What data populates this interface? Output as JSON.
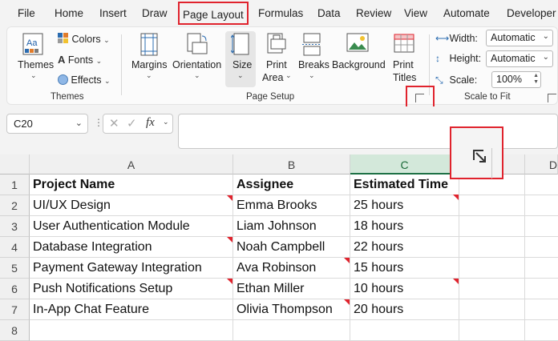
{
  "tabs": [
    "File",
    "Home",
    "Insert",
    "Draw",
    "Page Layout",
    "Formulas",
    "Data",
    "Review",
    "View",
    "Automate",
    "Developer"
  ],
  "active_tab": "Page Layout",
  "ribbon": {
    "themes_group": {
      "themes_label": "Themes",
      "colors_label": "Colors",
      "fonts_label": "Fonts",
      "effects_label": "Effects",
      "group_label": "Themes"
    },
    "page_setup_group": {
      "margins_label": "Margins",
      "orientation_label": "Orientation",
      "size_label": "Size",
      "print_area_label_1": "Print",
      "print_area_label_2": "Area",
      "breaks_label": "Breaks",
      "background_label": "Background",
      "print_titles_label_1": "Print",
      "print_titles_label_2": "Titles",
      "group_label": "Page Setup"
    },
    "scale_group": {
      "width_label": "Width:",
      "width_value": "Automatic",
      "height_label": "Height:",
      "height_value": "Automatic",
      "scale_label": "Scale:",
      "scale_value": "100%",
      "group_label": "Scale to Fit"
    }
  },
  "formula_bar": {
    "name_box": "C20",
    "fx_label": "fx",
    "formula": ""
  },
  "sheet": {
    "columns": [
      "A",
      "B",
      "C",
      "D"
    ],
    "selected_column": "C",
    "row_numbers": [
      "1",
      "2",
      "3",
      "4",
      "5",
      "6",
      "7",
      "8"
    ],
    "headers": [
      "Project Name",
      "Assignee",
      "Estimated Time"
    ],
    "rows": [
      [
        "UI/UX Design",
        "Emma Brooks",
        "25 hours"
      ],
      [
        "User Authentication Module",
        "Liam Johnson",
        "18 hours"
      ],
      [
        "Database Integration",
        "Noah Campbell",
        "22 hours"
      ],
      [
        "Payment Gateway Integration",
        "Ava Robinson",
        "15 hours"
      ],
      [
        "Push Notifications Setup",
        "Ethan Miller",
        "10 hours"
      ],
      [
        "In-App Chat Feature",
        "Olivia Thompson",
        "20 hours"
      ]
    ]
  },
  "colors": {
    "highlight": "#e0232d",
    "selected_header": "#d3e8da",
    "selected_header_text": "#1d6b3a"
  }
}
